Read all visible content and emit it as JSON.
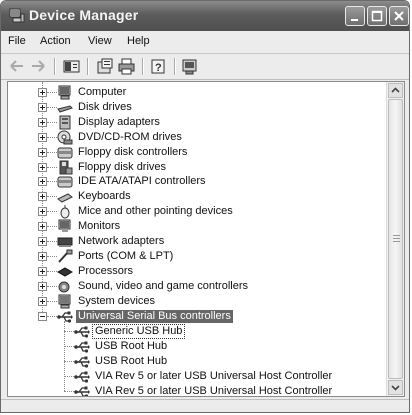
{
  "window": {
    "title": "Device Manager",
    "title_icon": "device-manager-icon"
  },
  "menu": [
    "File",
    "Action",
    "View",
    "Help"
  ],
  "toolbar": [
    "back-arrow-icon",
    "forward-arrow-icon",
    "show-hide-console-tree-icon",
    "properties-icon",
    "print-icon",
    "help-icon",
    "scan-hardware-icon"
  ],
  "tree": {
    "categories": [
      {
        "label": "Computer",
        "icon": "computer-icon"
      },
      {
        "label": "Disk drives",
        "icon": "disk-drive-icon"
      },
      {
        "label": "Display adapters",
        "icon": "display-adapter-icon"
      },
      {
        "label": "DVD/CD-ROM drives",
        "icon": "dvd-cdrom-icon"
      },
      {
        "label": "Floppy disk controllers",
        "icon": "floppy-controller-icon"
      },
      {
        "label": "Floppy disk drives",
        "icon": "floppy-drive-icon"
      },
      {
        "label": "IDE ATA/ATAPI controllers",
        "icon": "ide-controller-icon"
      },
      {
        "label": "Keyboards",
        "icon": "keyboard-icon"
      },
      {
        "label": "Mice and other pointing devices",
        "icon": "mouse-icon"
      },
      {
        "label": "Monitors",
        "icon": "monitor-icon"
      },
      {
        "label": "Network adapters",
        "icon": "network-adapter-icon"
      },
      {
        "label": "Ports (COM & LPT)",
        "icon": "ports-icon"
      },
      {
        "label": "Processors",
        "icon": "processor-icon"
      },
      {
        "label": "Sound, video and game controllers",
        "icon": "sound-icon"
      },
      {
        "label": "System devices",
        "icon": "system-devices-icon"
      },
      {
        "label": "Universal Serial Bus controllers",
        "icon": "usb-icon",
        "expanded": true,
        "selected": true
      }
    ],
    "usb_children": [
      {
        "label": "Generic USB Hub",
        "icon": "usb-icon",
        "focused": true
      },
      {
        "label": "USB Root Hub",
        "icon": "usb-icon"
      },
      {
        "label": "USB Root Hub",
        "icon": "usb-icon"
      },
      {
        "label": "VIA Rev 5 or later USB Universal Host Controller",
        "icon": "usb-icon"
      },
      {
        "label": "VIA Rev 5 or later USB Universal Host Controller",
        "icon": "usb-icon"
      }
    ]
  }
}
